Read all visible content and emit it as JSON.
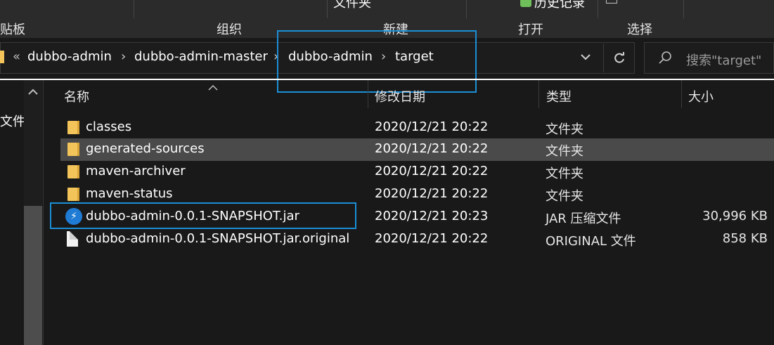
{
  "ribbon": {
    "top_partial": [
      "文件夹",
      "历史记录"
    ],
    "groups": [
      "贴板",
      "组织",
      "新建",
      "打开",
      "选择"
    ]
  },
  "address": {
    "overflow": "«",
    "crumbs": [
      "dubbo-admin",
      "dubbo-admin-master",
      "dubbo-admin",
      "target"
    ],
    "dropdown_icon": "chevron-down-icon",
    "refresh_icon": "refresh-icon"
  },
  "search": {
    "placeholder": "搜索\"target\"",
    "icon": "search-icon"
  },
  "nav": {
    "partial_label": "文件"
  },
  "columns": {
    "name": "名称",
    "modified": "修改日期",
    "type": "类型",
    "size": "大小"
  },
  "files": [
    {
      "name": "classes",
      "modified": "2020/12/21 20:22",
      "type": "文件夹",
      "size": "",
      "icon": "folder-icon"
    },
    {
      "name": "generated-sources",
      "modified": "2020/12/21 20:22",
      "type": "文件夹",
      "size": "",
      "icon": "folder-icon",
      "selected": true
    },
    {
      "name": "maven-archiver",
      "modified": "2020/12/21 20:22",
      "type": "文件夹",
      "size": "",
      "icon": "folder-icon"
    },
    {
      "name": "maven-status",
      "modified": "2020/12/21 20:22",
      "type": "文件夹",
      "size": "",
      "icon": "folder-icon"
    },
    {
      "name": "dubbo-admin-0.0.1-SNAPSHOT.jar",
      "modified": "2020/12/21 20:23",
      "type": "JAR 压缩文件",
      "size": "30,996 KB",
      "icon": "jar-icon"
    },
    {
      "name": "dubbo-admin-0.0.1-SNAPSHOT.jar.original",
      "modified": "2020/12/21 20:22",
      "type": "ORIGINAL 文件",
      "size": "858 KB",
      "icon": "file-icon"
    }
  ],
  "colors": {
    "highlight": "#1a8fd6",
    "background": "#191919",
    "selected_row": "#4a4a4a"
  }
}
